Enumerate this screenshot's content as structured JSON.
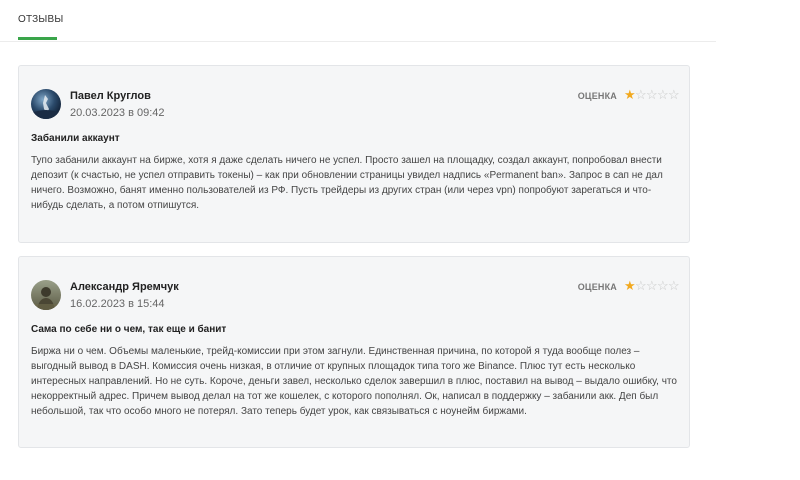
{
  "tabs": {
    "reviews_label": "ОТЗЫВЫ"
  },
  "reviews": [
    {
      "author": "Павел Круглов",
      "date": "20.03.2023 в 09:42",
      "rating_label": "ОЦЕНКА",
      "rating": 1,
      "rating_max": 5,
      "title": "Забанили аккаунт",
      "text": "Тупо забанили аккаунт на бирже, хотя я даже сделать ничего не успел. Просто зашел на площадку, создал аккаунт, попробовал внести депозит (к счастью, не успел отправить токены) – как при обновлении страницы увидел надпись «Permanent ban». Запрос в сап не дал ничего. Возможно, банят именно пользователей из РФ. Пусть трейдеры из других стран (или через vpn) попробуют зарегаться и что-нибудь сделать, а потом отпишутся."
    },
    {
      "author": "Александр Яремчук",
      "date": "16.02.2023 в 15:44",
      "rating_label": "ОЦЕНКА",
      "rating": 1,
      "rating_max": 5,
      "title": "Сама по себе ни о чем, так еще и банит",
      "text": "Биржа ни о чем. Объемы маленькие, трейд-комиссии при этом загнули. Единственная причина, по которой я туда вообще полез – выгодный вывод в DASH. Комиссия очень низкая, в отличие от крупных площадок типа того же Binance. Плюс тут есть несколько интересных направлений. Но не суть. Короче, деньги завел, несколько сделок завершил в плюс, поставил на вывод – выдало ошибку, что некорректный адрес. Причем вывод делал на тот же кошелек, с которого пополнял. Ок, написал в поддержку – забанили акк. Деп был небольшой, так что особо много не потерял. Зато теперь будет урок, как связываться с ноунейм биржами."
    }
  ],
  "colors": {
    "accent": "#3aa54a",
    "star_filled": "#f2a91f",
    "star_empty": "#c8c8c8",
    "card_bg": "#f5f6f7"
  }
}
